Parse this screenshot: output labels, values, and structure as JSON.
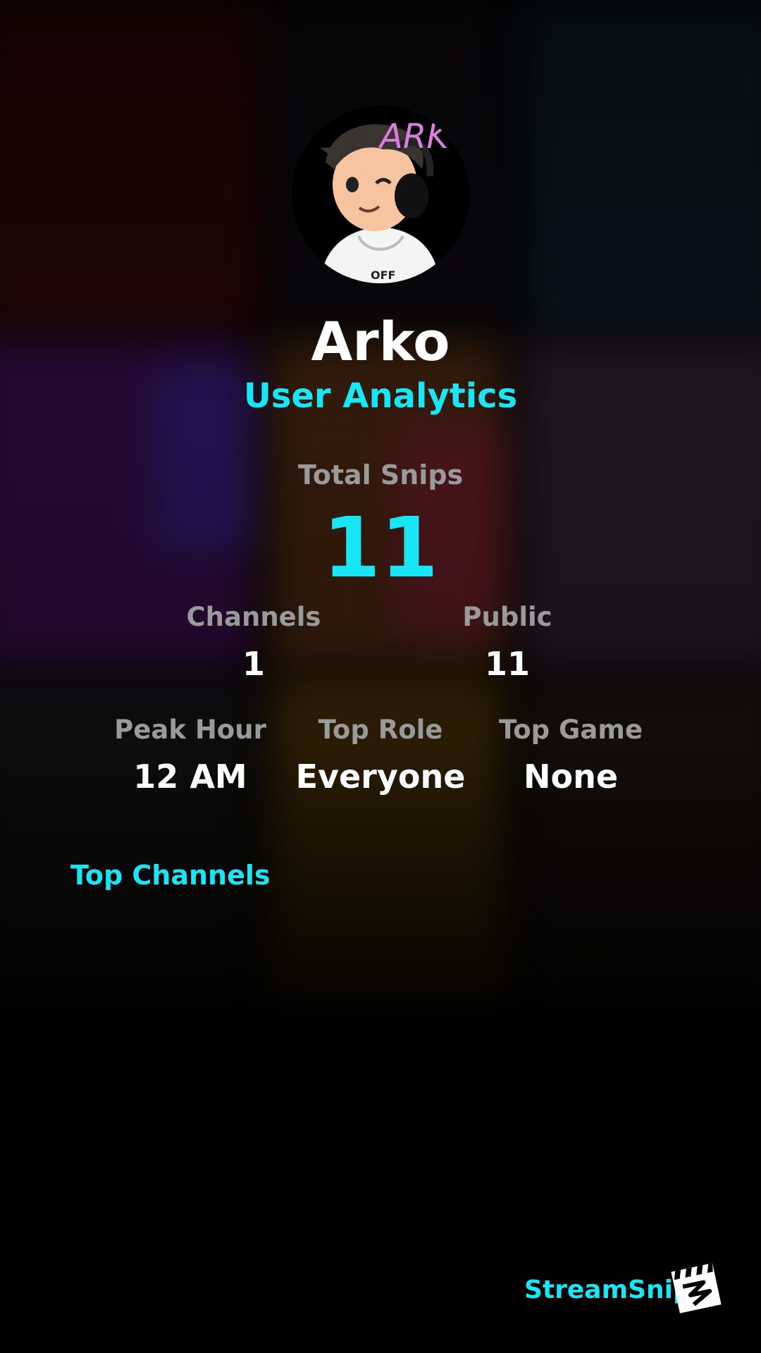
{
  "profile": {
    "name": "Arko",
    "subtitle": "User Analytics",
    "avatar_text": "ARK",
    "avatar_shirt_text": "OFF"
  },
  "total_snips": {
    "label": "Total Snips",
    "value": "11"
  },
  "stats_row1": [
    {
      "label": "Channels",
      "value": "1"
    },
    {
      "label": "Public",
      "value": "11"
    }
  ],
  "stats_row2": [
    {
      "label": "Peak Hour",
      "value": "12 AM"
    },
    {
      "label": "Top Role",
      "value": "Everyone"
    },
    {
      "label": "Top Game",
      "value": "None"
    }
  ],
  "sections": {
    "top_channels": "Top Channels"
  },
  "brand": {
    "name": "StreamSnip",
    "icon": "clapperboard-icon"
  },
  "colors": {
    "accent": "#19e6f5",
    "muted": "#9a9a9a",
    "text": "#ffffff",
    "background": "#000000"
  }
}
